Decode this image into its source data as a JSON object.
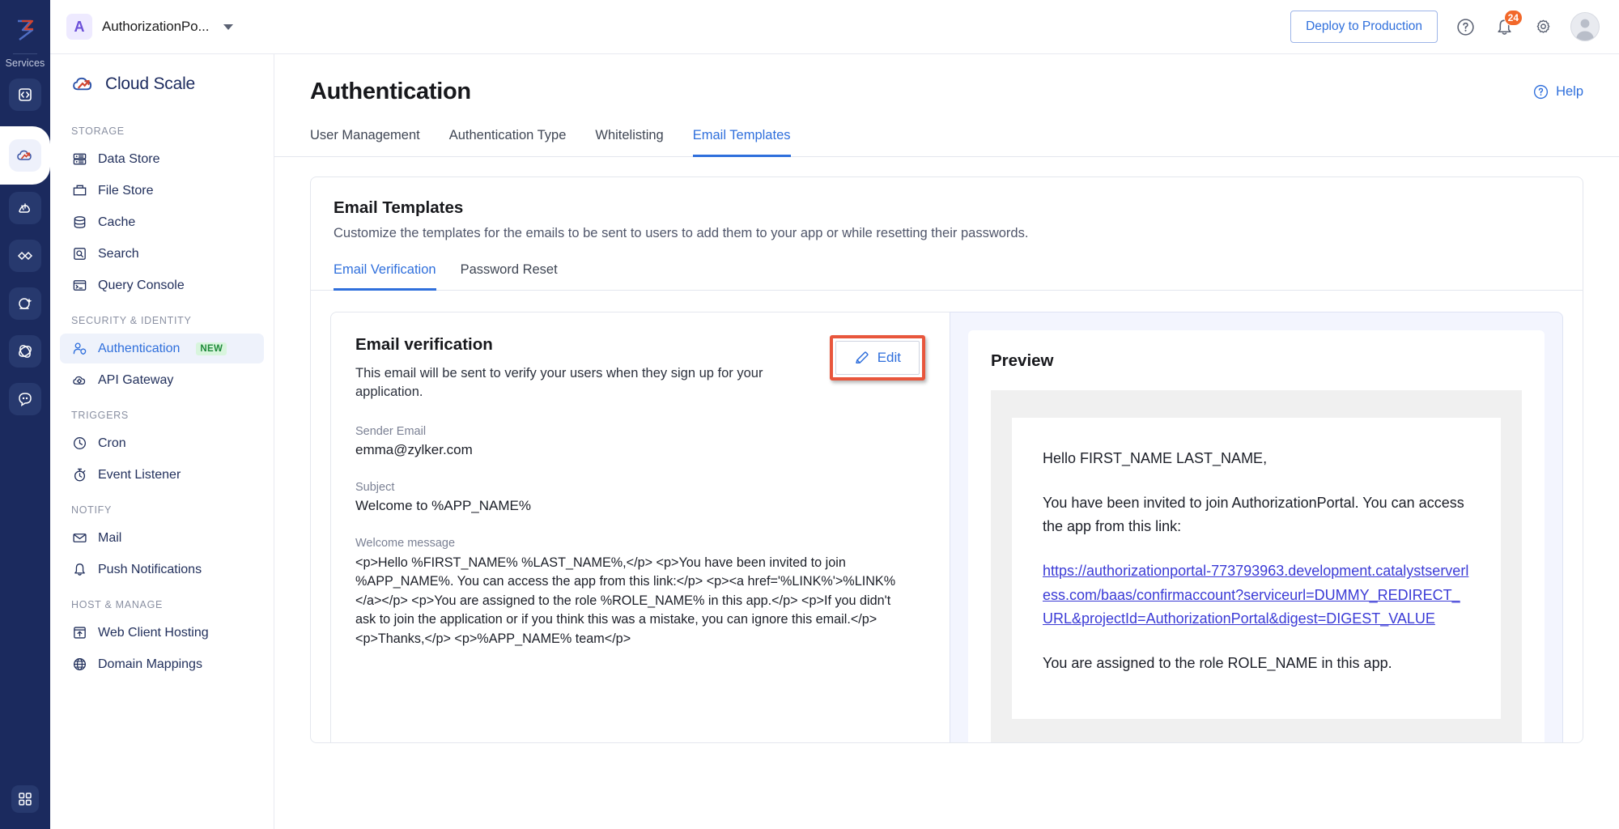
{
  "rail": {
    "services_label": "Services",
    "items": [
      {
        "name": "code-icon",
        "label": "Code"
      },
      {
        "name": "cloud-scale-icon",
        "label": "Cloud Scale"
      },
      {
        "name": "analytics-icon",
        "label": "Analytics"
      },
      {
        "name": "integration-icon",
        "label": "Integration"
      },
      {
        "name": "ai-icon",
        "label": "AI"
      },
      {
        "name": "orbit-icon",
        "label": "Orbit"
      },
      {
        "name": "chat-icon",
        "label": "Chat"
      }
    ],
    "bottom_item": {
      "name": "apps-grid-icon",
      "label": "Apps"
    }
  },
  "topbar": {
    "project_initial": "A",
    "project_name": "AuthorizationPo...",
    "deploy_label": "Deploy to Production",
    "help_icon": "question-circle-icon",
    "notifications_icon": "bell-icon",
    "notification_count": "24",
    "settings_icon": "gear-icon",
    "avatar_icon": "user-avatar"
  },
  "nav": {
    "brand": "Cloud Scale",
    "groups": [
      {
        "title": "STORAGE",
        "items": [
          {
            "label": "Data Store",
            "icon": "data-store-icon",
            "active": false,
            "badge": ""
          },
          {
            "label": "File Store",
            "icon": "file-store-icon",
            "active": false,
            "badge": ""
          },
          {
            "label": "Cache",
            "icon": "cache-icon",
            "active": false,
            "badge": ""
          },
          {
            "label": "Search",
            "icon": "search-icon",
            "active": false,
            "badge": ""
          },
          {
            "label": "Query Console",
            "icon": "query-console-icon",
            "active": false,
            "badge": ""
          }
        ]
      },
      {
        "title": "SECURITY & IDENTITY",
        "items": [
          {
            "label": "Authentication",
            "icon": "authentication-icon",
            "active": true,
            "badge": "NEW"
          },
          {
            "label": "API Gateway",
            "icon": "api-gateway-icon",
            "active": false,
            "badge": ""
          }
        ]
      },
      {
        "title": "TRIGGERS",
        "items": [
          {
            "label": "Cron",
            "icon": "clock-icon",
            "active": false,
            "badge": ""
          },
          {
            "label": "Event Listener",
            "icon": "stopwatch-icon",
            "active": false,
            "badge": ""
          }
        ]
      },
      {
        "title": "NOTIFY",
        "items": [
          {
            "label": "Mail",
            "icon": "mail-icon",
            "active": false,
            "badge": ""
          },
          {
            "label": "Push Notifications",
            "icon": "bell-icon",
            "active": false,
            "badge": ""
          }
        ]
      },
      {
        "title": "HOST & MANAGE",
        "items": [
          {
            "label": "Web Client Hosting",
            "icon": "web-hosting-icon",
            "active": false,
            "badge": ""
          },
          {
            "label": "Domain Mappings",
            "icon": "globe-icon",
            "active": false,
            "badge": ""
          }
        ]
      }
    ]
  },
  "page": {
    "title": "Authentication",
    "help_label": "Help",
    "help_icon": "question-circle-icon",
    "tabs": [
      {
        "label": "User Management",
        "active": false
      },
      {
        "label": "Authentication Type",
        "active": false
      },
      {
        "label": "Whitelisting",
        "active": false
      },
      {
        "label": "Email Templates",
        "active": true
      }
    ]
  },
  "panel": {
    "title": "Email Templates",
    "description": "Customize the templates for the emails to be sent to users to add them to your app or while resetting their passwords.",
    "subtabs": [
      {
        "label": "Email Verification",
        "active": true
      },
      {
        "label": "Password Reset",
        "active": false
      }
    ]
  },
  "template": {
    "heading": "Email verification",
    "description": "This email will be sent to verify your users when they sign up for your application.",
    "edit_label": "Edit",
    "edit_icon": "pencil-icon",
    "fields": [
      {
        "label": "Sender Email",
        "value": "emma@zylker.com"
      },
      {
        "label": "Subject",
        "value": "Welcome to %APP_NAME%"
      }
    ],
    "message_label": "Welcome message",
    "message_value": "<p>Hello %FIRST_NAME% %LAST_NAME%,</p> <p>You have been invited to join %APP_NAME%. You can access the app from this link:</p> <p><a href='%LINK%'>%LINK%</a></p> <p>You are assigned to the role %ROLE_NAME% in this app.</p> <p>If you didn't ask to join the application or if you think this was a mistake, you can ignore this email.</p> <p>Thanks,</p> <p>%APP_NAME% team</p>"
  },
  "preview": {
    "title": "Preview",
    "greeting": "Hello FIRST_NAME LAST_NAME,",
    "invite_line": "You have been invited to join AuthorizationPortal. You can access the app from this link:",
    "link": "https://authorizationportal-773793963.development.catalystserverless.com/baas/confirmaccount?serviceurl=DUMMY_REDIRECT_URL&projectId=AuthorizationPortal&digest=DIGEST_VALUE",
    "role_line": "You are assigned to the role ROLE_NAME in this app."
  },
  "colors": {
    "accent_blue": "#2f6fdc",
    "rail_navy": "#1b2a5e",
    "highlight_red": "#e8563c",
    "badge_orange": "#f2682a",
    "new_green": "#1f8a3b"
  }
}
